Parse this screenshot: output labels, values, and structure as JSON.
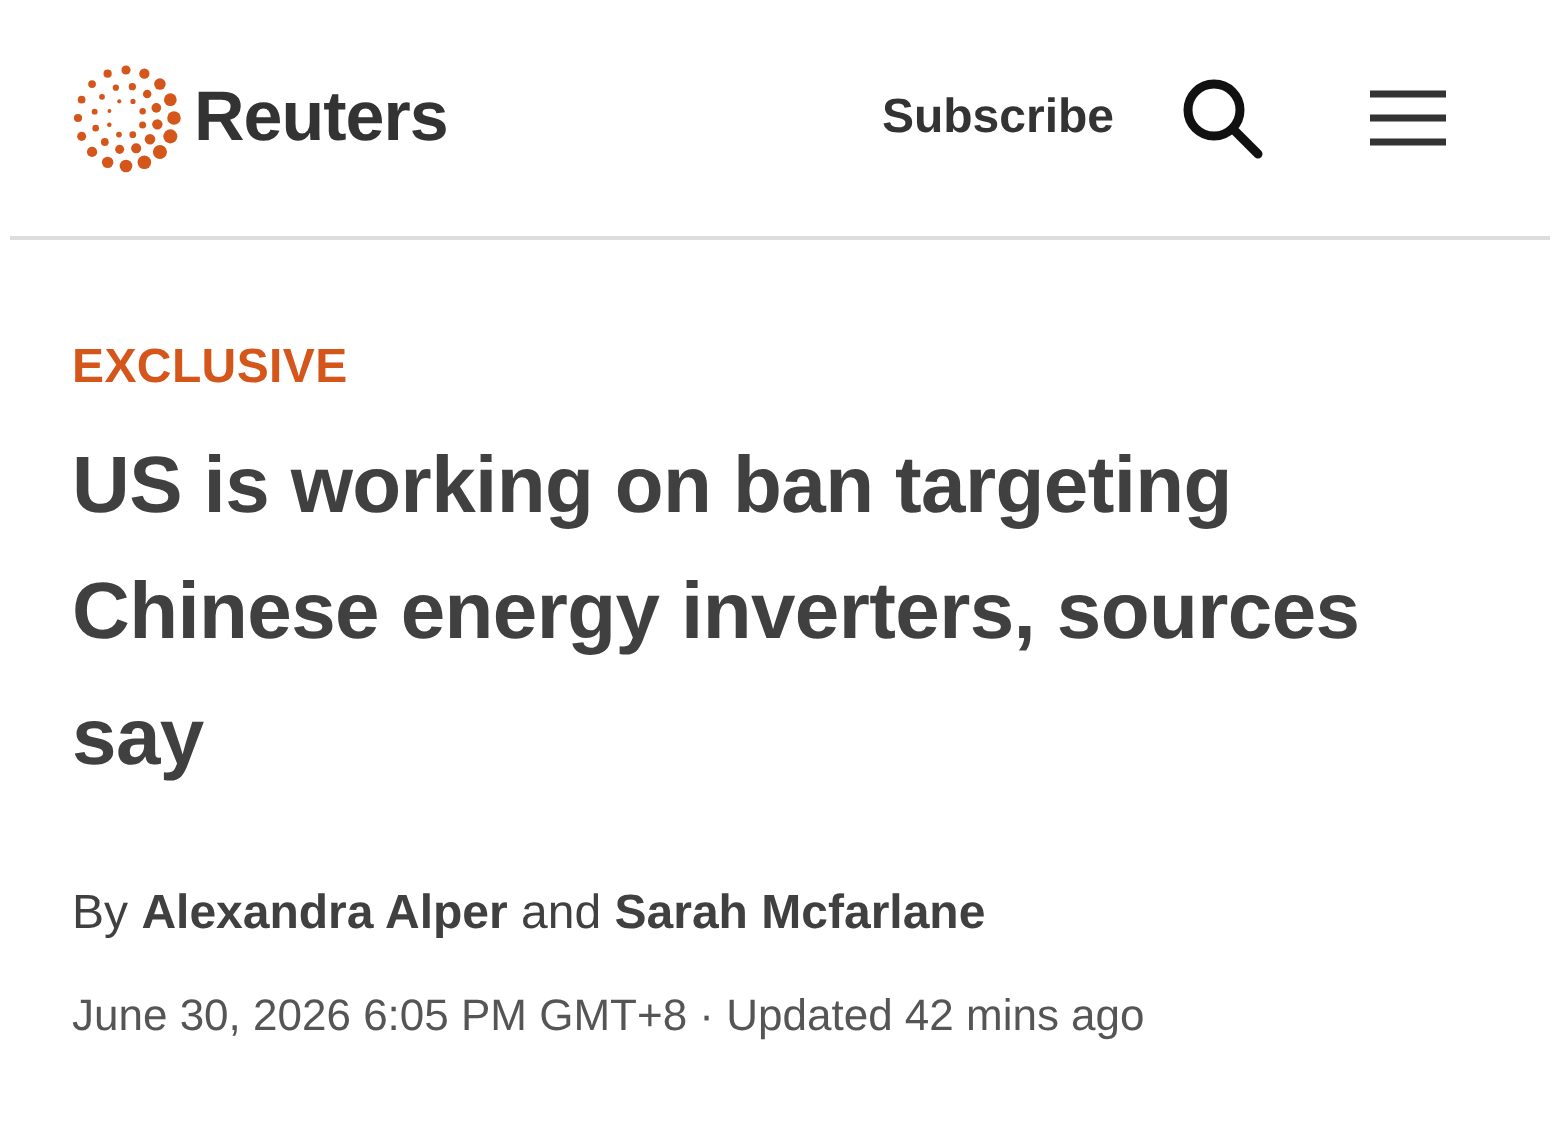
{
  "header": {
    "logo_text": "Reuters",
    "subscribe": "Subscribe"
  },
  "article": {
    "label": "EXCLUSIVE",
    "headline": "US is working on ban targeting Chinese energy inverters, sources say",
    "byline": "By **Alexandra Alper** and **Sarah Mcfarlane**",
    "dateline": "June 30, 2026 6:05 PM GMT+8 · Updated 42 mins ago"
  }
}
